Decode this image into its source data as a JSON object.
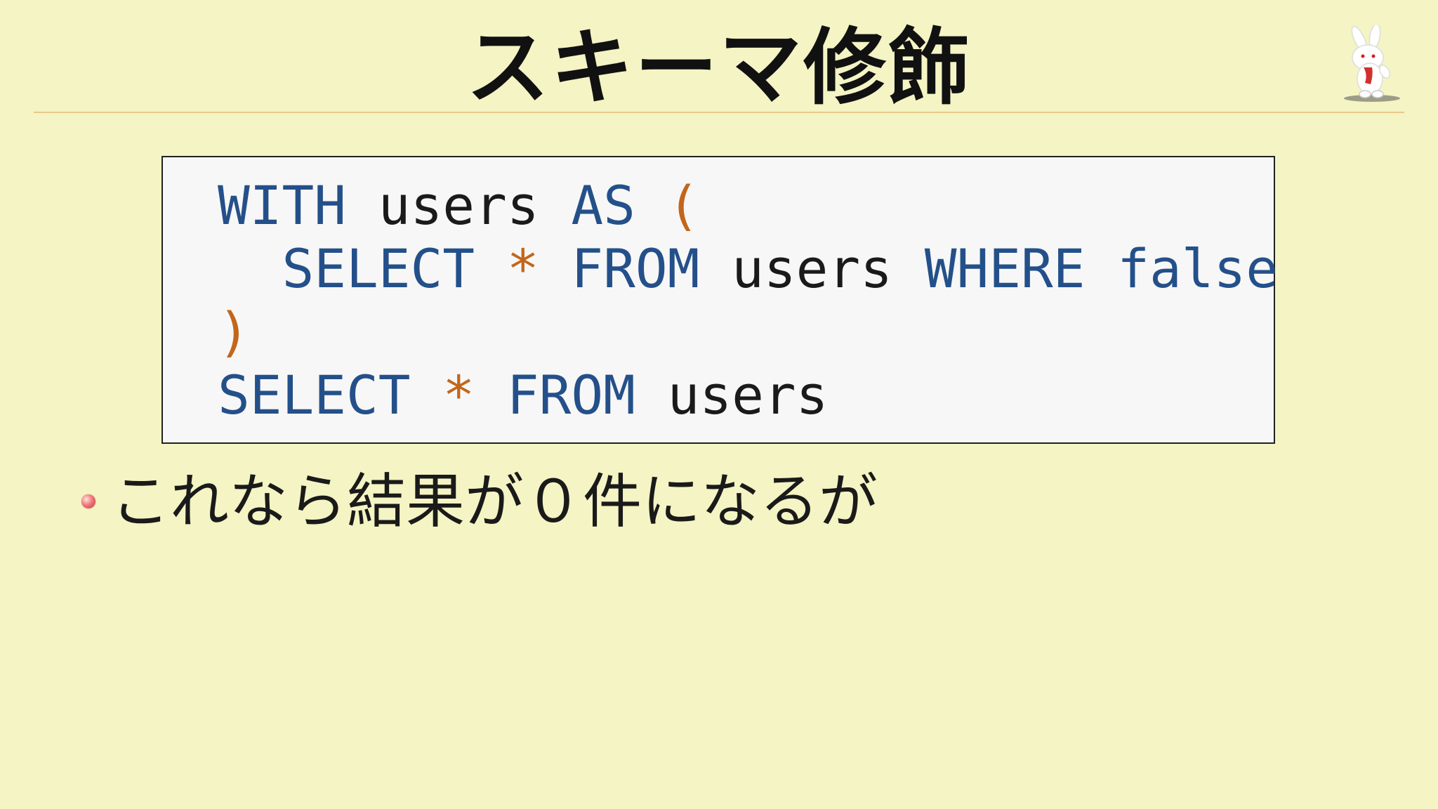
{
  "slide": {
    "title": "スキーマ修飾",
    "background_color": "#f4f4c4",
    "rule_color": "#e8c98a"
  },
  "code": {
    "keyword_color": "#24508a",
    "operator_color": "#c2661a",
    "identifier_color": "#1a1a1a",
    "lines": [
      {
        "tokens": [
          {
            "text": "WITH",
            "kind": "kw"
          },
          {
            "text": " ",
            "kind": "id"
          },
          {
            "text": "users",
            "kind": "id"
          },
          {
            "text": " ",
            "kind": "id"
          },
          {
            "text": "AS",
            "kind": "kw"
          },
          {
            "text": " ",
            "kind": "id"
          },
          {
            "text": "(",
            "kind": "op"
          }
        ]
      },
      {
        "tokens": [
          {
            "text": "  ",
            "kind": "id"
          },
          {
            "text": "SELECT",
            "kind": "kw"
          },
          {
            "text": " ",
            "kind": "id"
          },
          {
            "text": "*",
            "kind": "op"
          },
          {
            "text": " ",
            "kind": "id"
          },
          {
            "text": "FROM",
            "kind": "kw"
          },
          {
            "text": " ",
            "kind": "id"
          },
          {
            "text": "users",
            "kind": "id"
          },
          {
            "text": " ",
            "kind": "id"
          },
          {
            "text": "WHERE",
            "kind": "kw"
          },
          {
            "text": " ",
            "kind": "id"
          },
          {
            "text": "false",
            "kind": "kw"
          }
        ]
      },
      {
        "tokens": [
          {
            "text": ")",
            "kind": "op"
          }
        ]
      },
      {
        "tokens": [
          {
            "text": "SELECT",
            "kind": "kw"
          },
          {
            "text": " ",
            "kind": "id"
          },
          {
            "text": "*",
            "kind": "op"
          },
          {
            "text": " ",
            "kind": "id"
          },
          {
            "text": "FROM",
            "kind": "kw"
          },
          {
            "text": " ",
            "kind": "id"
          },
          {
            "text": "users",
            "kind": "id"
          }
        ]
      }
    ]
  },
  "bullets": [
    {
      "text": "これなら結果が０件になるが"
    }
  ],
  "mascot": {
    "icon": "rabbit-mascot-icon"
  }
}
